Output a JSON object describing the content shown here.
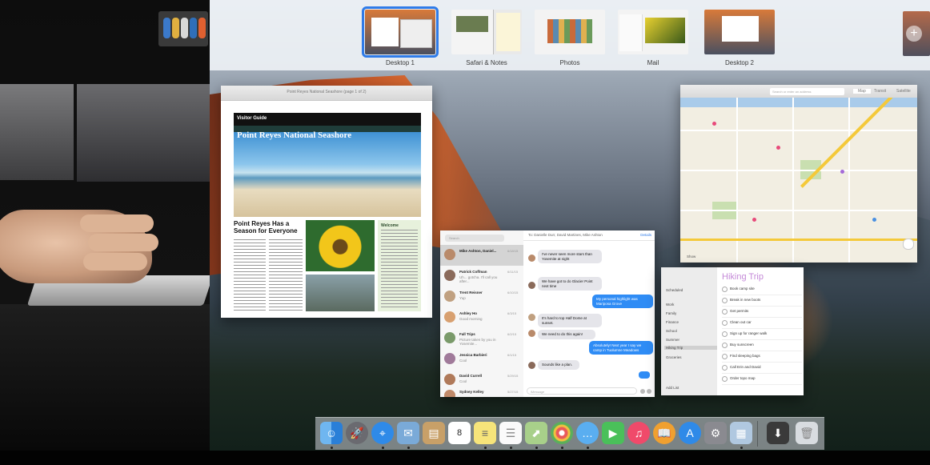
{
  "spaces": [
    {
      "label": "Desktop 1",
      "active": true
    },
    {
      "label": "Safari & Notes",
      "active": false
    },
    {
      "label": "Photos",
      "active": false
    },
    {
      "label": "Mail",
      "active": false
    },
    {
      "label": "Desktop 2",
      "active": false
    }
  ],
  "add_space_label": "+",
  "preview": {
    "title": "Point Reyes National Seashore (page 1 of 2)",
    "brochure_label": "Visitor Guide",
    "brochure_title": "Point Reyes National Seashore",
    "subhead": "Point Reyes Has a Season for Everyone",
    "welcome": "Welcome"
  },
  "messages": {
    "search_placeholder": "Search",
    "recipients": "To: Danielle Durr, David Martines, Mike Ashton",
    "details_label": "Details",
    "input_placeholder": "iMessage",
    "conversations": [
      {
        "name": "Mike Ashton, Daniel...",
        "preview": "",
        "date": "6/18/15"
      },
      {
        "name": "Patrick Coffman",
        "preview": "Uh... gotcha. I'll call you after...",
        "date": "6/11/15"
      },
      {
        "name": "Trent Reisner",
        "preview": "Yup",
        "date": "6/10/15"
      },
      {
        "name": "Ashley Ho",
        "preview": "Good morning",
        "date": "6/3/15"
      },
      {
        "name": "Fall Trips",
        "preview": "Picture taken by you in Yosemite...",
        "date": "6/2/15"
      },
      {
        "name": "Jessica Barbieri",
        "preview": "Cool",
        "date": "6/1/15"
      },
      {
        "name": "David Currell",
        "preview": "Cool",
        "date": "5/29/15"
      },
      {
        "name": "Sydney Kelley",
        "preview": "Thanks! I'll see you later",
        "date": "5/27/15"
      }
    ],
    "bubbles": [
      {
        "dir": "in",
        "text": "I've never seen more stars than Yosemite at night"
      },
      {
        "dir": "in",
        "text": "We have got to do Glacier Point next time"
      },
      {
        "dir": "out",
        "text": "My personal highlight was Mariposa Grove"
      },
      {
        "dir": "in",
        "text": "It's hard to top Half Dome at sunset."
      },
      {
        "dir": "in",
        "text": "We need to do this again!"
      },
      {
        "dir": "out",
        "text": "Absolutely! Next year I say we camp in Tuolumne Meadows"
      },
      {
        "dir": "in",
        "text": "Sounds like a plan."
      }
    ]
  },
  "reminders": {
    "sidebar": [
      "Scheduled",
      "Work",
      "Family",
      "Finance",
      "School",
      "Summer",
      "Hiking Trip",
      "Groceries"
    ],
    "selected": "Hiking Trip",
    "title": "Hiking Trip",
    "add_list": "Add List",
    "items": [
      "Book camp site",
      "Break in new boots",
      "Get permits",
      "Clean out car",
      "Sign up for ranger walk",
      "Buy sunscreen",
      "Find sleeping bags",
      "Call Erin and David",
      "Order topo map"
    ]
  },
  "maps": {
    "search_placeholder": "Search or enter an address",
    "tabs": [
      "Map",
      "Transit",
      "Satellite"
    ],
    "show_label": "Show"
  },
  "dock_apps": [
    "finder-icon",
    "launchpad-icon",
    "safari-icon",
    "mail-icon",
    "contacts-icon",
    "calendar-icon",
    "notes-icon",
    "reminders-icon",
    "maps-icon",
    "photos-icon",
    "messages-icon",
    "facetime-icon",
    "itunes-icon",
    "ibooks-icon",
    "app-store-icon",
    "system-preferences-icon",
    "preview-icon",
    "downloads-icon",
    "trash-icon"
  ],
  "calendar_day": "8",
  "colors": {
    "accent": "#2f7be8",
    "bubble_out": "#2f8cf5",
    "reminders_title": "#c58ad8"
  }
}
